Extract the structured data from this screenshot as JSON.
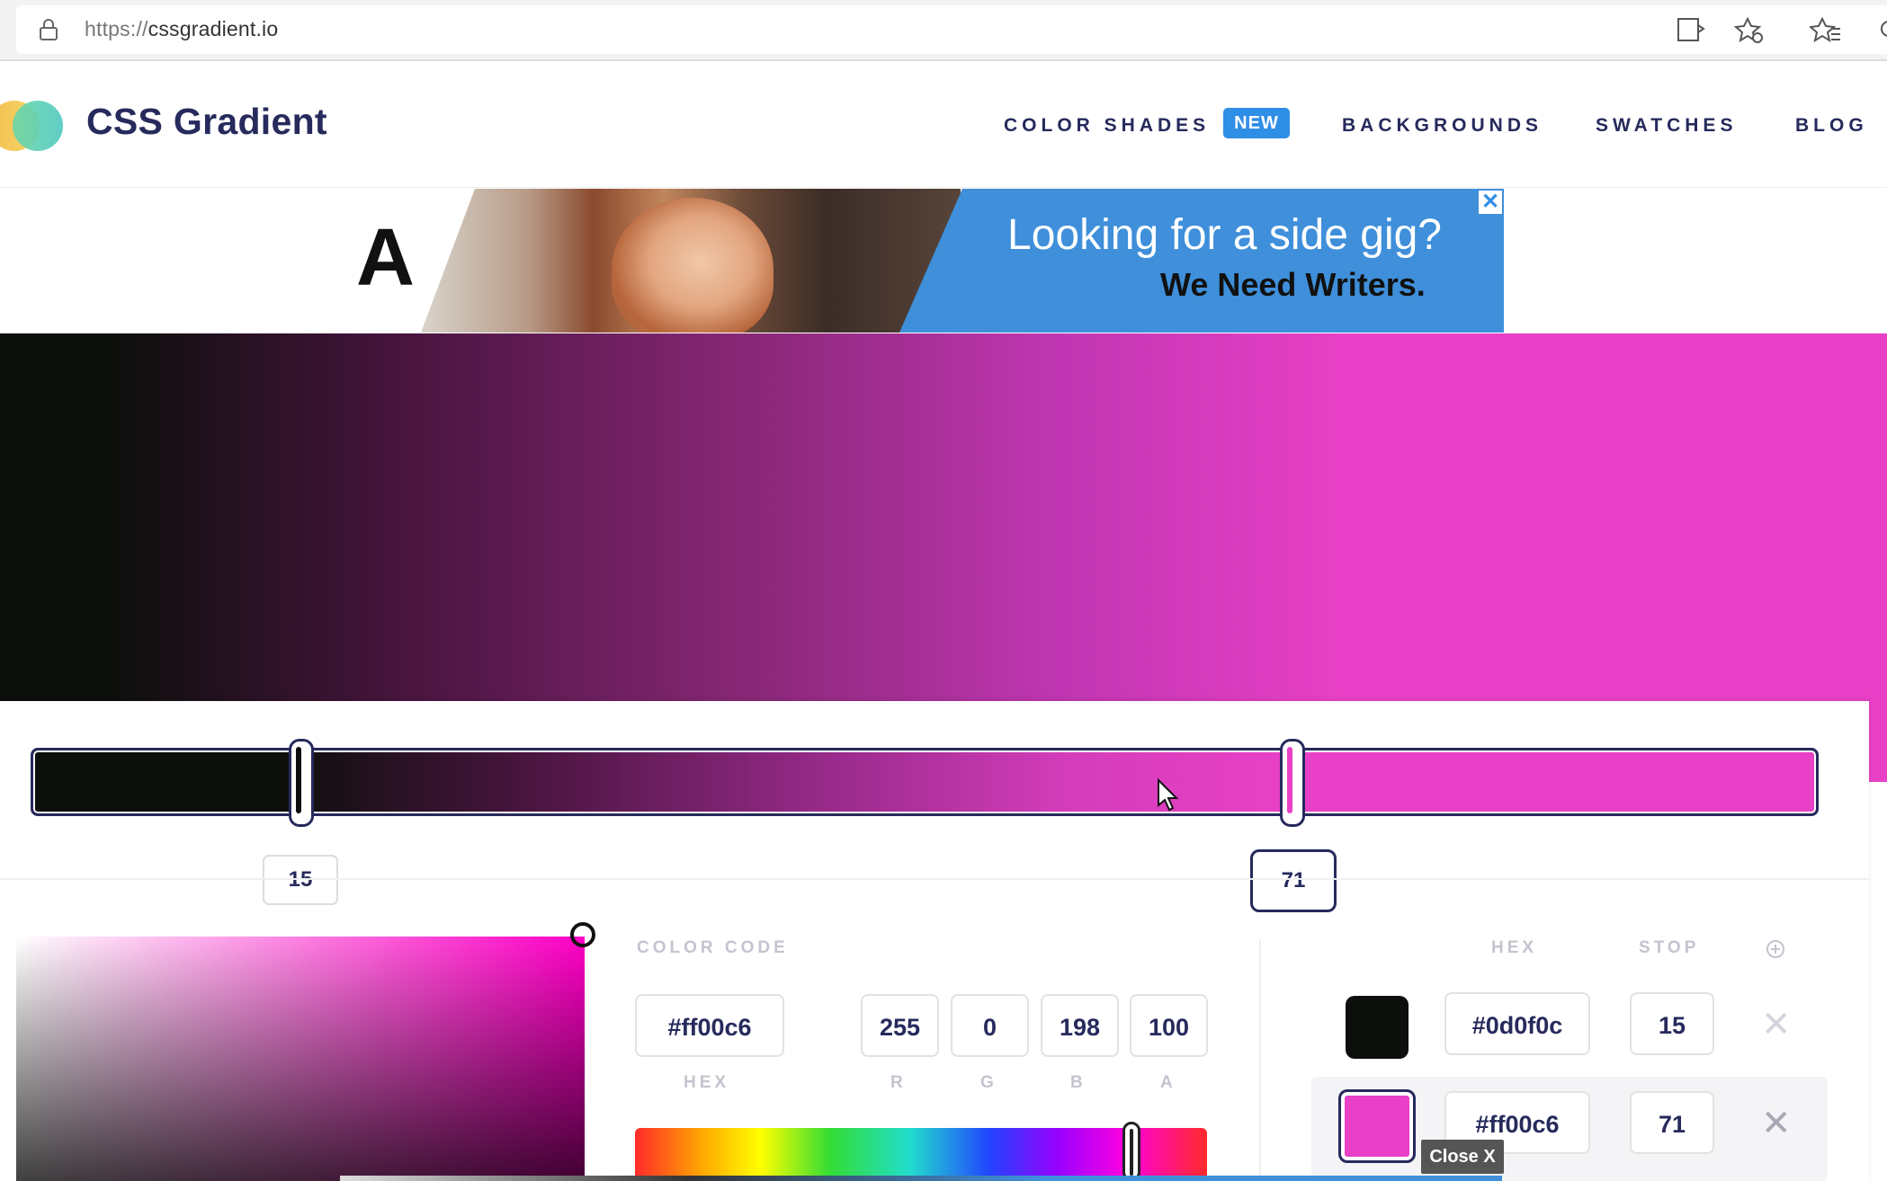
{
  "browser": {
    "url_protocol": "https://",
    "url_host": "cssgradient.io"
  },
  "header": {
    "brand": "CSS Gradient",
    "nav": [
      {
        "label": "COLOR SHADES",
        "badge": "NEW"
      },
      {
        "label": "BACKGROUNDS"
      },
      {
        "label": "SWATCHES"
      },
      {
        "label": "BLOG"
      }
    ]
  },
  "ad": {
    "logo_letter": "A",
    "headline": "Looking for a side gig?",
    "subline": "We Need Writers.",
    "close_glyph": "✕"
  },
  "gradient": {
    "stops": [
      {
        "hex": "#0d0f0c",
        "stop": "15"
      },
      {
        "hex": "#ff00c6",
        "stop": "71"
      }
    ]
  },
  "picker": {
    "section_label": "COLOR CODE",
    "hex_value": "#ff00c6",
    "hex_caption": "HEX",
    "r": "255",
    "g": "0",
    "b": "198",
    "a": "100",
    "r_caption": "R",
    "g_caption": "G",
    "b_caption": "B",
    "a_caption": "A"
  },
  "stops_table": {
    "col_hex": "HEX",
    "col_stop": "STOP",
    "rows": [
      {
        "color": "#0d0f0c",
        "hex": "#0d0f0c",
        "stop": "15"
      },
      {
        "color": "#ff00c6",
        "hex": "#ff00c6",
        "stop": "71"
      }
    ],
    "remove_glyph": "✕"
  },
  "tooltip": {
    "close_label": "Close X"
  },
  "colors": {
    "brand_navy": "#262a5c",
    "badge_blue": "#2f8ee6",
    "preview_pink": "#e840c6"
  }
}
